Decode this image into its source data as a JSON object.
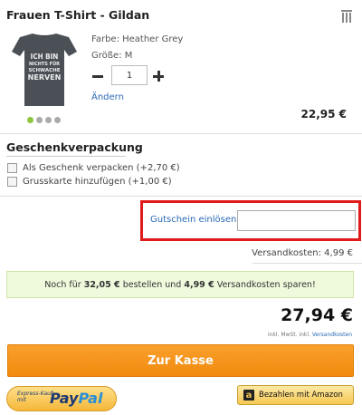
{
  "product": {
    "title": "Frauen T-Shirt - Gildan",
    "shirt_text": [
      "ICH BIN",
      "NICHTS FÜR",
      "SCHWACHE",
      "NERVEN"
    ],
    "color_line": "Farbe: Heather Grey",
    "size_line": "Größe: M",
    "quantity": "1",
    "change_link": "Ändern",
    "price": "22,95 €",
    "color_dots": 4,
    "active_dot": 0
  },
  "gift": {
    "title": "Geschenkverpackung",
    "option_wrap": "Als Geschenk verpacken (+2,70 €)",
    "option_card": "Grusskarte hinzufügen (+1,00 €)"
  },
  "coupon": {
    "label": "Gutschein einlösen",
    "value": ""
  },
  "shipping": {
    "text": "Versandkosten: 4,99 €"
  },
  "notice": {
    "part1": "Noch für ",
    "amount": "32,05 €",
    "part2": " bestellen und ",
    "shipping": "4,99 €",
    "part3": " Versandkosten sparen!"
  },
  "total": {
    "amount": "27,94 €",
    "vat_prefix": "inkl. MwSt. inkl. ",
    "vat_link": "Versandkosten"
  },
  "checkout": {
    "label": "Zur Kasse"
  },
  "paypal": {
    "small_line1": "Express-Kauf",
    "small_line2": "mit",
    "pay": "Pay",
    "pal": "Pal"
  },
  "amazon": {
    "icon": "a",
    "label": "Bezahlen mit Amazon"
  },
  "colors": {
    "accent_orange": "#f28a0e",
    "highlight_red": "#e01b1b",
    "link_blue": "#2a6ab8",
    "notice_green_bg": "#effadc",
    "active_dot_green": "#8cc63f"
  }
}
